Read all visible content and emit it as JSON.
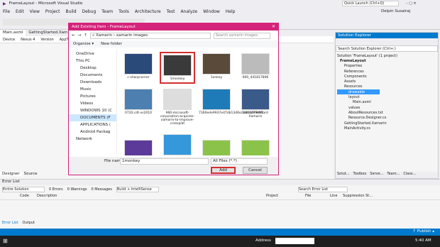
{
  "window": {
    "title": "FrameLayout - Microsoft Visual Studio",
    "quick_launch": "Quick Launch (Ctrl+Q)",
    "user": "Delpin Susairaj"
  },
  "menu": [
    "File",
    "Edit",
    "View",
    "Project",
    "Build",
    "Debug",
    "Team",
    "Tools",
    "Architecture",
    "Test",
    "Analyze",
    "Window",
    "Help"
  ],
  "editor_tabs": [
    "Main.axml",
    "GettingStarted.Xam"
  ],
  "device_bar": {
    "device": "Device",
    "nexus": "Nexus 4",
    "version": "Version",
    "theme": "AppTh"
  },
  "designer_tabs": [
    "Designer",
    "Source"
  ],
  "dialog": {
    "title": "Add Existing Item - FrameLayout",
    "breadcrumb": "« Xamarin › xamarin images",
    "search_placeholder": "Search xamarin images",
    "organize": "Organize ▾",
    "new_folder": "New folder",
    "nav": [
      "OneDrive",
      "This PC",
      "Desktop",
      "Documents",
      "Downloads",
      "Music",
      "Pictures",
      "Videos",
      "WINDOWS 10 (C",
      "DOCUMENTS (F",
      "APPLICATIONS (",
      "Android Packag",
      "Network"
    ],
    "files": [
      "c-sharpcorner",
      "1monkey",
      "1onkey",
      "600_441817806",
      "0720.cdt-vs2010",
      "960-microsoft-corporation-acquires-xamarin-to-improve-crossplat",
      "7360ede9937e47db13d6e2d64dd79c41",
      "140329SMWard Xamarin",
      "",
      "",
      "",
      ""
    ],
    "file_name_label": "File name:",
    "file_name_value": "1monkey",
    "file_type": "All Files (*.*)",
    "add_button": "Add",
    "cancel_button": "Cancel"
  },
  "solution_explorer": {
    "title": "Solution Explorer",
    "search": "Search Solution Explorer (Ctrl+;)",
    "items": [
      "Solution 'FrameLayout' (1 project)",
      "FrameLayout",
      "Properties",
      "References",
      "Components",
      "Assets",
      "Resources",
      "drawable",
      "layout",
      "Main.axml",
      "values",
      "AboutResources.txt",
      "Resource.Designer.cs",
      "GettingStarted.Xamarin",
      "MainActivity.cs"
    ],
    "tabs": [
      "Solut...",
      "Toolbox",
      "Serve...",
      "Team...",
      "Class..."
    ]
  },
  "error_list": {
    "title": "Error List",
    "scope": "Entire Solution",
    "errors": "0 Errors",
    "warnings": "0 Warnings",
    "messages": "0 Messages",
    "build": "Build + IntelliSense",
    "search": "Search Error List",
    "columns": [
      "Code",
      "Description",
      "Project",
      "File",
      "Line",
      "Suppression St..."
    ],
    "tabs": [
      "Error List",
      "Output"
    ]
  },
  "status": {
    "publish": "↑ Publish ▴"
  },
  "taskbar": {
    "address": "Address",
    "time": "5:40 AM"
  }
}
